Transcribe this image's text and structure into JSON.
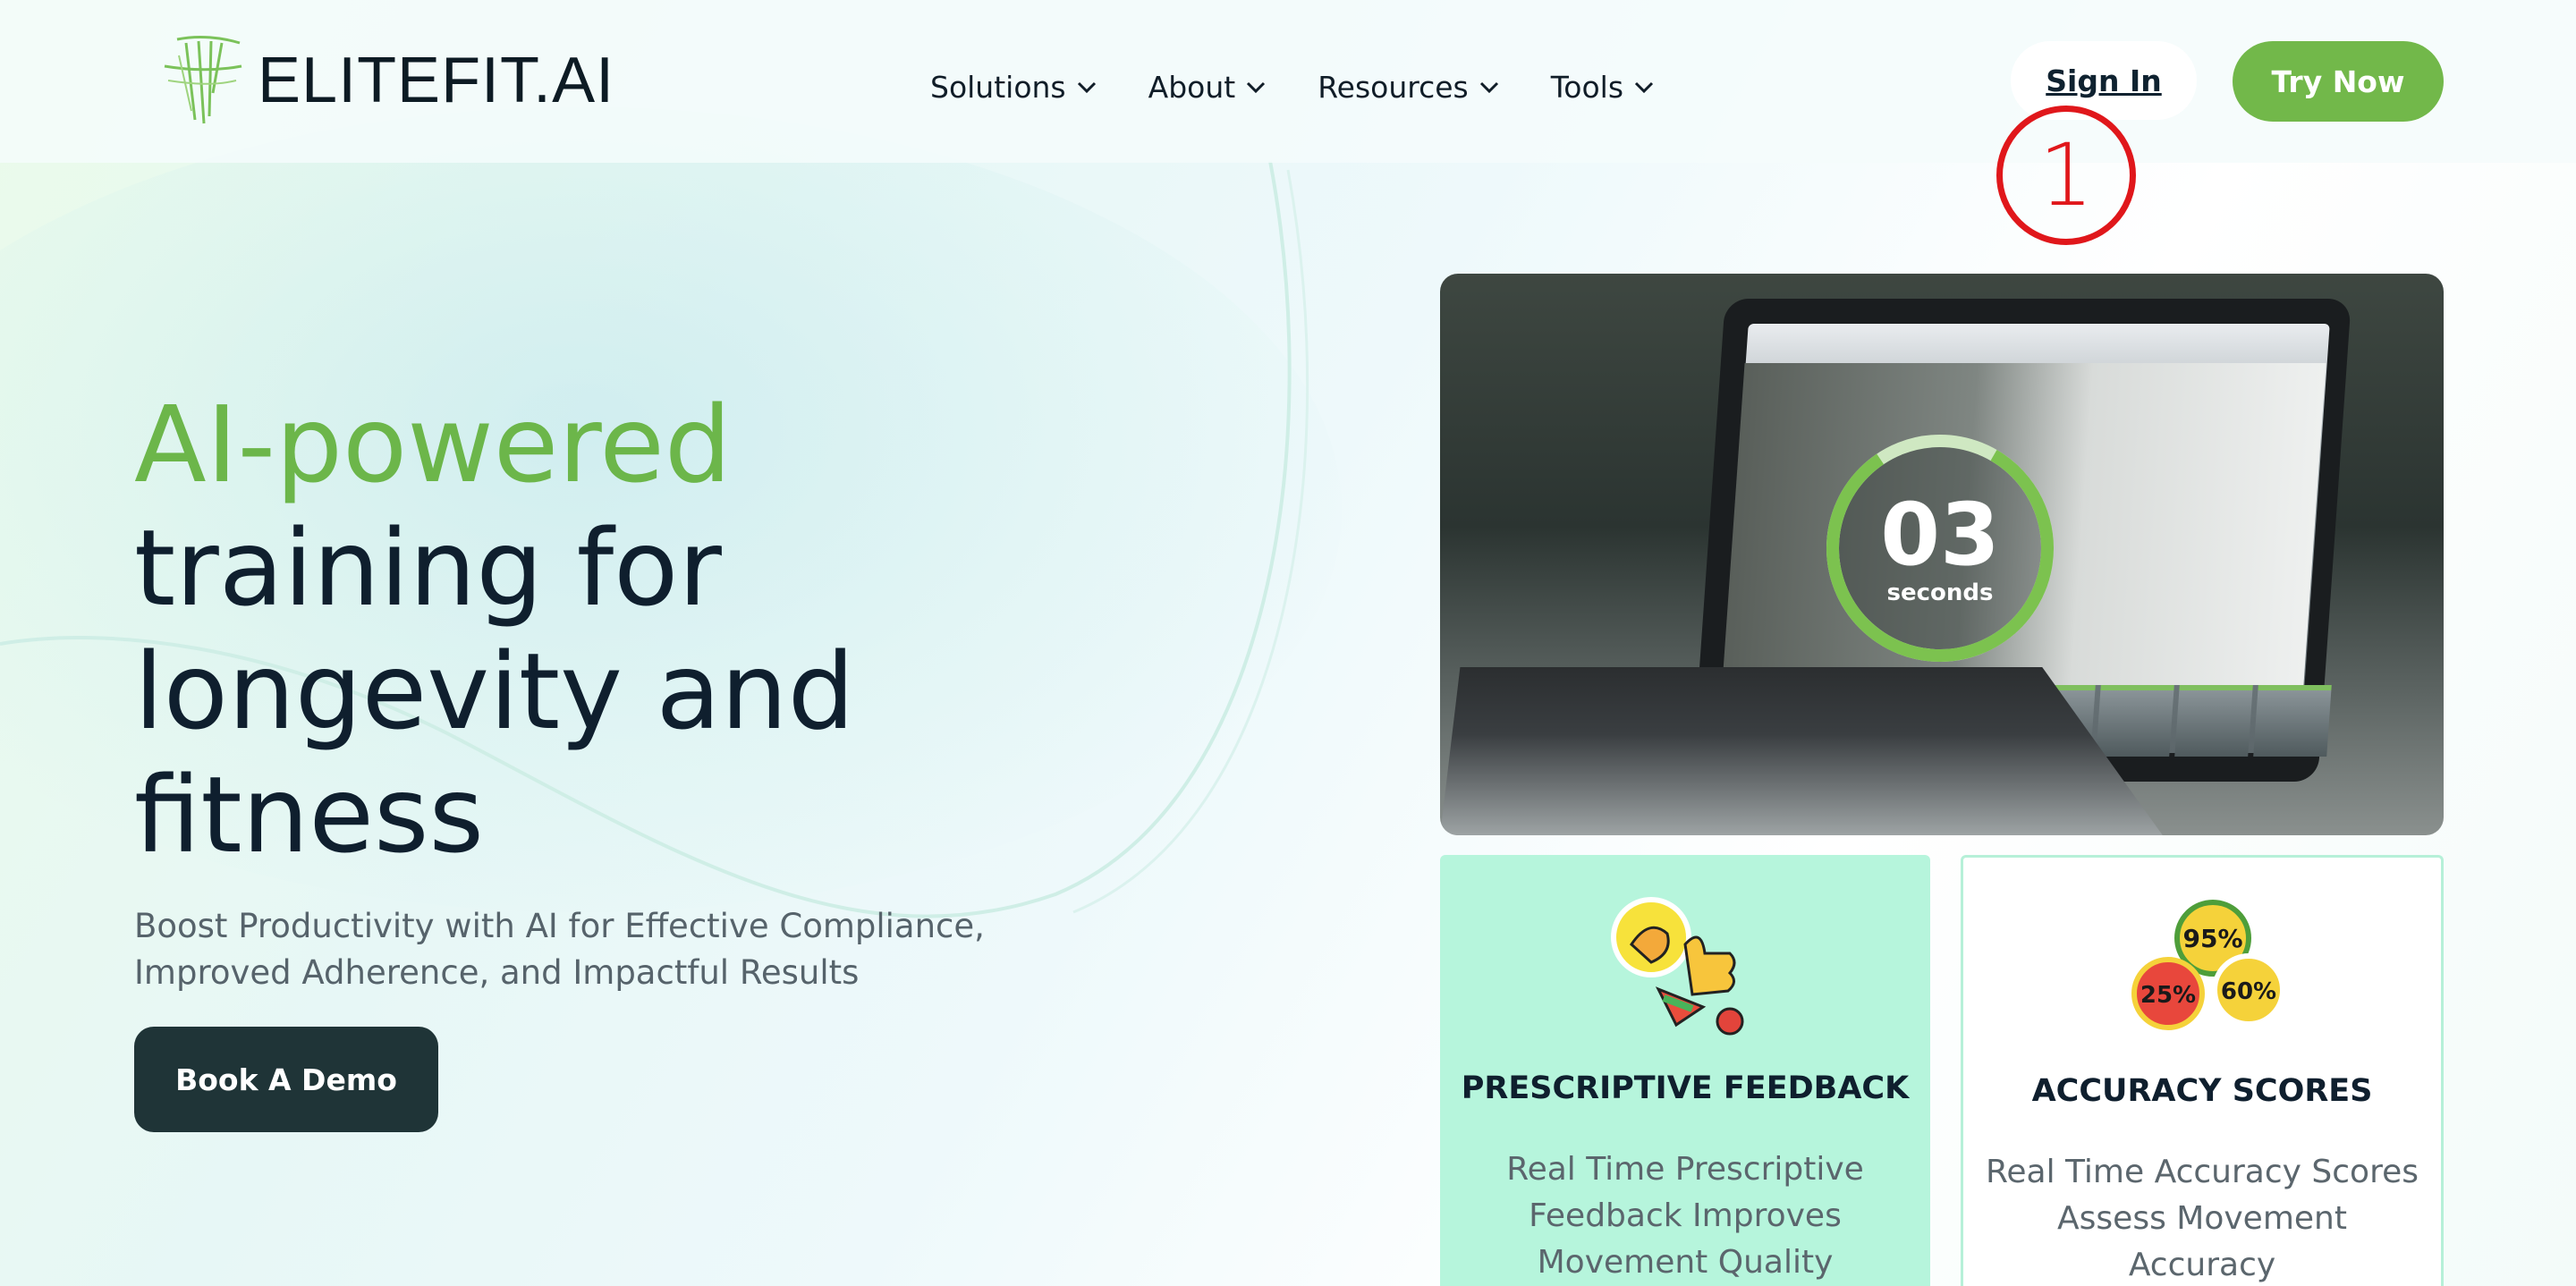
{
  "header": {
    "brand": "ELITEFIT.AI",
    "logo_icon": "palm-leaf-logo-icon",
    "nav": [
      {
        "label": "Solutions",
        "icon": "chevron-down-icon"
      },
      {
        "label": "About",
        "icon": "chevron-down-icon"
      },
      {
        "label": "Resources",
        "icon": "chevron-down-icon"
      },
      {
        "label": "Tools",
        "icon": "chevron-down-icon"
      }
    ],
    "sign_in": "Sign In",
    "try_now": "Try Now"
  },
  "annotation": {
    "marker_number": "1",
    "color": "#e0171b"
  },
  "hero": {
    "title_accent": "AI-powered",
    "title_line2": "training for",
    "title_line3": "longevity and",
    "title_line4": "fitness",
    "subtitle": "Boost Productivity with AI for Effective Compliance, Improved Adherence, and Impactful Results",
    "cta": "Book A Demo"
  },
  "video": {
    "countdown": "03",
    "countdown_label": "seconds"
  },
  "features": [
    {
      "title": "PRESCRIPTIVE FEEDBACK",
      "text": "Real Time Prescriptive Feedback Improves Movement Quality",
      "icon": "thumbs-up-sticker-icon"
    },
    {
      "title": "ACCURACY SCORES",
      "text": "Real Time Accuracy Scores Assess Movement Accuracy",
      "icon": "percentage-badges-icon",
      "badges": [
        "95%",
        "25%",
        "60%"
      ]
    }
  ],
  "colors": {
    "accent_green": "#6cb64a",
    "button_green": "#72b84a",
    "dark_button": "#1f3437",
    "feature_mint": "#b6f5dc",
    "heading_dark": "#0f1f2e"
  }
}
